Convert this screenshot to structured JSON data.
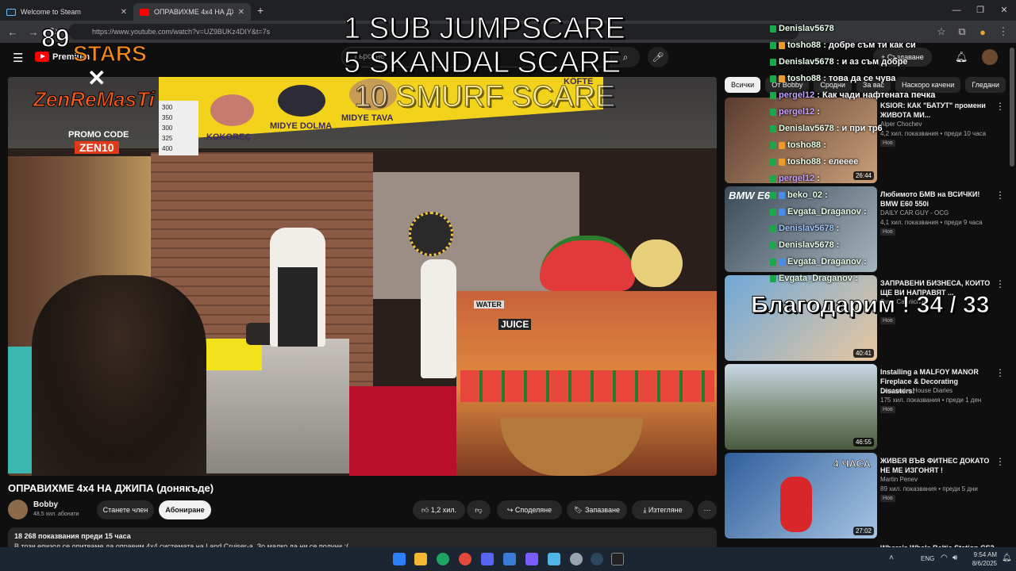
{
  "browser": {
    "tabs": [
      {
        "label": "Welcome to Steam",
        "close": "✕",
        "color": "#1b2838"
      },
      {
        "label": "ОПРАВИХМЕ 4x4 НА ДЖИ",
        "close": "✕",
        "color": "#ff0000"
      }
    ],
    "new_tab": "+",
    "window_controls": [
      "—",
      "❐",
      "✕"
    ],
    "url": "https://www.youtube.com/watch?v=UZ9BUKz4DIY&t=7s"
  },
  "youtube": {
    "logo_text": "Premium",
    "search_placeholder": "Търсене",
    "create_label": "Създаване",
    "video_title": "ОПРАВИХМЕ 4x4 НА ДЖИПА (донякъде)",
    "channel": {
      "name": "Bobby",
      "subscribers": "48,5 хил. абонати"
    },
    "join_label": "Станете член",
    "subscribe_label": "Абониране",
    "like_count": "1,2 хил.",
    "share_label": "Споделяне",
    "save_label": "Запазване",
    "download_label": "Изтегляне",
    "more": "⋯",
    "description": {
      "stats": "18 268 показвания  преди 15 часа",
      "text": "В този епизод се опитваме да оправим 4х4 системата на Land Cruiser-a. Зо малко да ни се получи :("
    },
    "player_signs": {
      "kokorec": "KOKOREÇ",
      "midye_dolma": "MIDYE DOLMA",
      "midye_tava": "MIDYE TAVA",
      "kofte": "KÖFTE",
      "juice": "JUICE",
      "watermelon": "WATER",
      "price_menu": [
        "300",
        "350",
        "300",
        "325",
        "400"
      ]
    },
    "filters": [
      {
        "label": "Всички",
        "active": true
      },
      {
        "label": "От Bobby",
        "active": false
      },
      {
        "label": "Сродни",
        "active": false
      },
      {
        "label": "За вас",
        "active": false
      },
      {
        "label": "Наскоро качени",
        "active": false
      },
      {
        "label": "Гледани",
        "active": false
      }
    ],
    "recommendations": [
      {
        "title": "KSIOR: КАК \"БАТУТ\" промени ЖИВОТА МИ...",
        "channel": "Alper Chochev",
        "meta": "4,2 хил. показвания • преди 10 часа",
        "badge": "Нов",
        "duration": "26:44",
        "color": "#5a3b2e"
      },
      {
        "title": "Любимото БМВ на ВСИЧКИ! BMW E60 550i",
        "channel": "DAILY CAR GUY - OCG",
        "meta": "4,1 хил. показвания • преди 9 часа",
        "badge": "Нов",
        "duration": "",
        "color": "#3a4a58",
        "thumb_text": "BMW E60"
      },
      {
        "title": "ЗАПРАВЕНИ БИЗНЕСА, КОИТО ЩЕ ВИ НАПРАВЯТ ...",
        "channel": "Evan Carmichael",
        "meta": "",
        "badge": "Нов",
        "duration": "40:41",
        "color": "#6fa8d8"
      },
      {
        "title": "Installing a MALFOY MANOR Fireplace & Decorating Disasters!",
        "channel": "Duncombe House Diaries",
        "meta": "175 хил. показвания • преди 1 ден",
        "badge": "Нов",
        "duration": "46:55",
        "color": "#7a8a76"
      },
      {
        "title": "ЖИВЕЯ ВЪВ ФИТНЕС ДОКАТО НЕ МЕ ИЗГОНЯТ !",
        "channel": "Martin Penev",
        "meta": "89 хил. показвания • преди 5 дни",
        "badge": "Нов",
        "duration": "27:02",
        "color": "#2e5f9a",
        "thumb_text": "4 ЧАСА"
      }
    ],
    "next_rec_partial": "Where's Whale Baltic Station CS2"
  },
  "overlay": {
    "goal_lines": [
      "1 SUB JUMPSCARE",
      "5 SKANDAL SCARE",
      "10 SMURF SCARE"
    ],
    "stars_count": "89",
    "stars_label": "STARS",
    "promo_brand": "ZenReMasTi",
    "promo_label": "PROMO CODE",
    "promo_code": "ZEN10",
    "thanks": "Благодарим ! 34 / 33",
    "chat": [
      {
        "user": "Denislav5678",
        "msg": ""
      },
      {
        "user": "tosho88",
        "msg": ": добре съм ти как си"
      },
      {
        "user": "Denislav5678",
        "msg": ": и аз съм добре"
      },
      {
        "user": "tosho88",
        "msg": ": това да се чува"
      },
      {
        "user": "pergel12",
        "msg": ": Как чади нафтената печка"
      },
      {
        "user": "pergel12",
        "msg": ":"
      },
      {
        "user": "Denislav5678",
        "msg": ": и при тр6"
      },
      {
        "user": "tosho88",
        "msg": ":"
      },
      {
        "user": "tosho88",
        "msg": ": елееее"
      },
      {
        "user": "pergel12",
        "msg": ":"
      },
      {
        "user": "beko_02",
        "msg": ":"
      },
      {
        "user": "Evgata_Draganov",
        "msg": ":"
      },
      {
        "user": "Denislav5678",
        "msg": ":"
      },
      {
        "user": "Denislav5678",
        "msg": ":"
      },
      {
        "user": "Evgata_Draganov",
        "msg": ":"
      },
      {
        "user": "Evgata_Draganov",
        "msg": ":"
      }
    ]
  },
  "taskbar": {
    "lang": "ENG",
    "time": "9:54 AM",
    "date": "8/6/2025",
    "icon_colors": [
      "#2d7ff9",
      "#f2b632",
      "#1da462",
      "#e44a3b",
      "#5865f2",
      "#3a7bd5",
      "#7a5cff",
      "#4fb6e8",
      "#9aa3ad",
      "#2a475e",
      "#222"
    ]
  }
}
